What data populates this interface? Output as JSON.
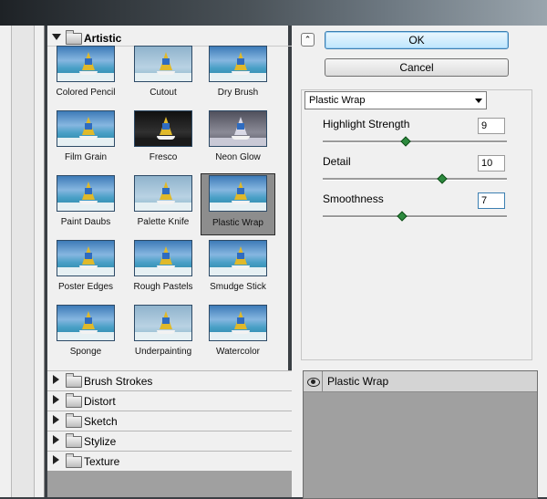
{
  "gallery": {
    "open_category": "Artistic",
    "filters": [
      {
        "label": "Colored Pencil",
        "style": ""
      },
      {
        "label": "Cutout",
        "style": "soft"
      },
      {
        "label": "Dry Brush",
        "style": ""
      },
      {
        "label": "Film Grain",
        "style": ""
      },
      {
        "label": "Fresco",
        "style": "dark"
      },
      {
        "label": "Neon Glow",
        "style": "glow"
      },
      {
        "label": "Paint Daubs",
        "style": ""
      },
      {
        "label": "Palette Knife",
        "style": "soft"
      },
      {
        "label": "Plastic Wrap",
        "style": "",
        "selected": true
      },
      {
        "label": "Poster Edges",
        "style": ""
      },
      {
        "label": "Rough Pastels",
        "style": ""
      },
      {
        "label": "Smudge Stick",
        "style": ""
      },
      {
        "label": "Sponge",
        "style": ""
      },
      {
        "label": "Underpainting",
        "style": "soft"
      },
      {
        "label": "Watercolor",
        "style": ""
      }
    ],
    "categories": [
      "Brush Strokes",
      "Distort",
      "Sketch",
      "Stylize",
      "Texture"
    ]
  },
  "buttons": {
    "ok_label": "OK",
    "cancel_label": "Cancel"
  },
  "settings": {
    "filter_select": "Plastic Wrap",
    "params": [
      {
        "label": "Highlight Strength",
        "value": "9",
        "fraction": 0.45
      },
      {
        "label": "Detail",
        "value": "10",
        "fraction": 0.65
      },
      {
        "label": "Smoothness",
        "value": "7",
        "fraction": 0.43
      }
    ]
  },
  "layers": {
    "active_layer": "Plastic Wrap"
  },
  "icons": {
    "collapse": "double-chevron-up-icon",
    "visibility": "eye-icon",
    "folder": "folder-icon"
  }
}
